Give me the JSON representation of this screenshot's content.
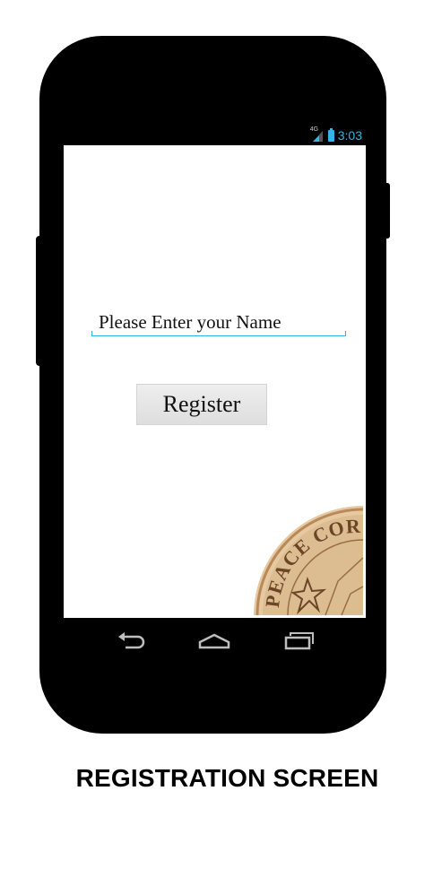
{
  "status_bar": {
    "network_label": "4G",
    "time": "3:03",
    "accent_color": "#33b5e5"
  },
  "form": {
    "name_placeholder": "Please Enter your Name",
    "name_value": "",
    "register_label": "Register"
  },
  "logo": {
    "text": "PEACE CORPS"
  },
  "nav_bar": {
    "back_icon": "back-icon",
    "home_icon": "home-icon",
    "recents_icon": "recent-apps-icon"
  },
  "caption": "REGISTRATION SCREEN"
}
